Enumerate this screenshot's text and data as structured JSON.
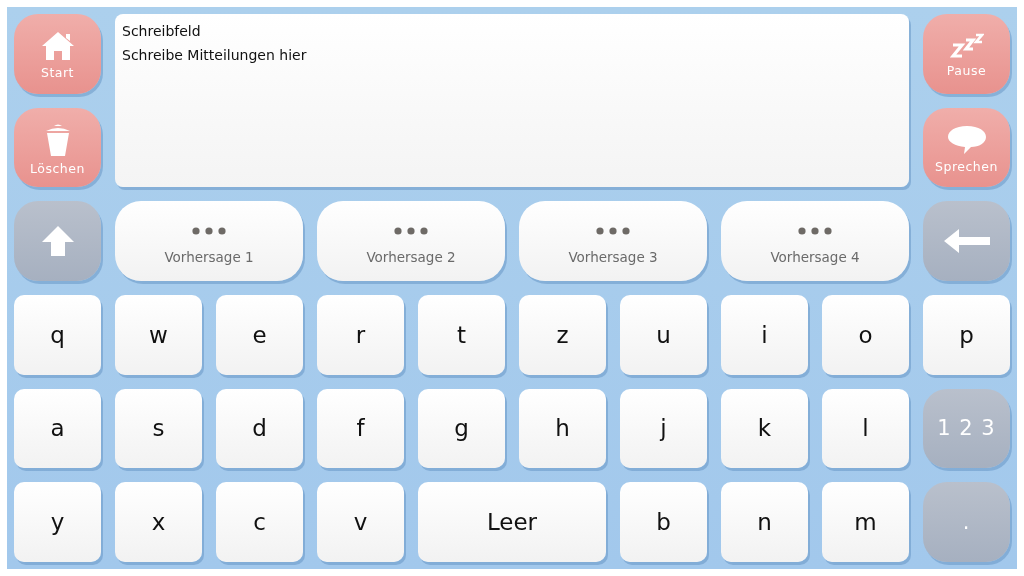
{
  "left_actions": [
    {
      "label": "Start"
    },
    {
      "label": "Löschen"
    }
  ],
  "right_actions": [
    {
      "label": "Pause"
    },
    {
      "label": "Sprechen"
    }
  ],
  "text_field": {
    "title": "Schreibfeld",
    "placeholder": "Schreibe Mitteilungen hier"
  },
  "predictions": [
    {
      "label": "Vorhersage 1"
    },
    {
      "label": "Vorhersage 2"
    },
    {
      "label": "Vorhersage 3"
    },
    {
      "label": "Vorhersage 4"
    }
  ],
  "keys": [
    {
      "kind": "letter",
      "label": "q"
    },
    {
      "kind": "letter",
      "label": "w"
    },
    {
      "kind": "letter",
      "label": "e"
    },
    {
      "kind": "letter",
      "label": "r"
    },
    {
      "kind": "letter",
      "label": "t"
    },
    {
      "kind": "letter",
      "label": "z"
    },
    {
      "kind": "letter",
      "label": "u"
    },
    {
      "kind": "letter",
      "label": "i"
    },
    {
      "kind": "letter",
      "label": "o"
    },
    {
      "kind": "letter",
      "label": "p"
    },
    {
      "kind": "letter",
      "label": "a"
    },
    {
      "kind": "letter",
      "label": "s"
    },
    {
      "kind": "letter",
      "label": "d"
    },
    {
      "kind": "letter",
      "label": "f"
    },
    {
      "kind": "letter",
      "label": "g"
    },
    {
      "kind": "letter",
      "label": "h"
    },
    {
      "kind": "letter",
      "label": "j"
    },
    {
      "kind": "letter",
      "label": "k"
    },
    {
      "kind": "letter",
      "label": "l"
    },
    {
      "kind": "mode",
      "label": "1 2 3"
    },
    {
      "kind": "letter",
      "label": "y"
    },
    {
      "kind": "letter",
      "label": "x"
    },
    {
      "kind": "letter",
      "label": "c"
    },
    {
      "kind": "letter",
      "label": "v"
    },
    {
      "kind": "space",
      "label": "Leer"
    },
    {
      "kind": "letter",
      "label": "b"
    },
    {
      "kind": "letter",
      "label": "n"
    },
    {
      "kind": "letter",
      "label": "m"
    },
    {
      "kind": "mode",
      "label": "."
    }
  ]
}
